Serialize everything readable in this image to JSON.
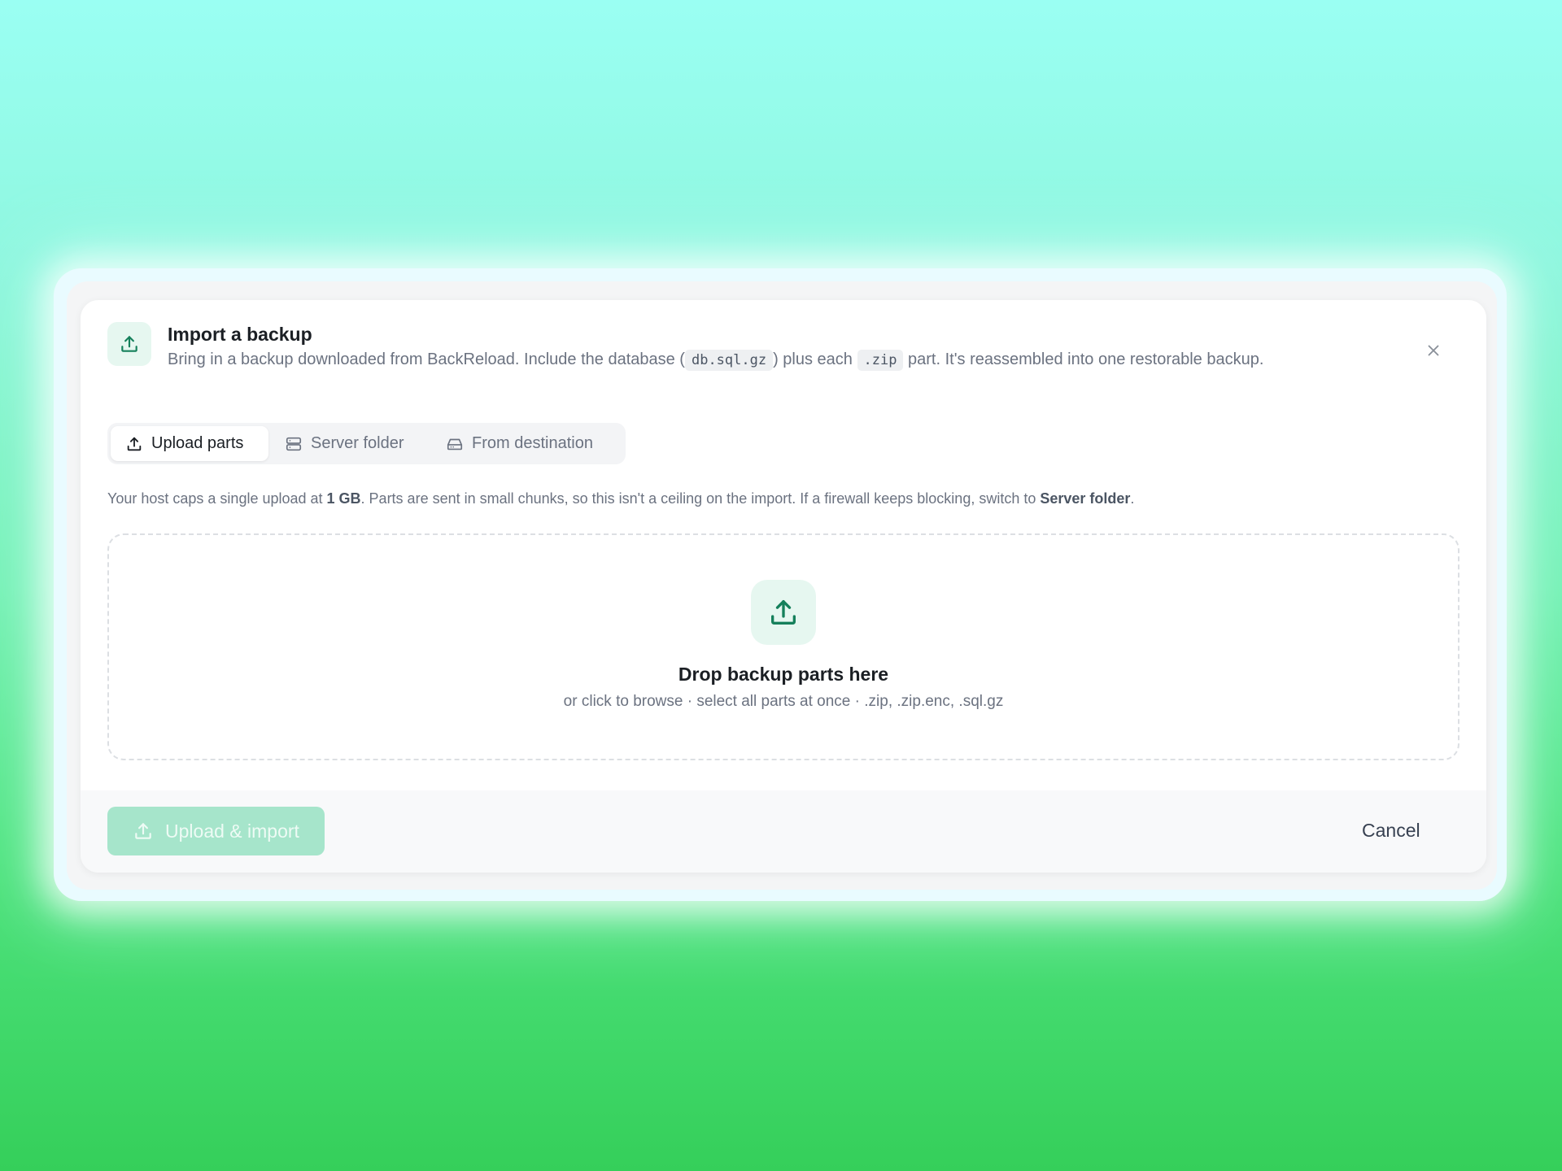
{
  "header": {
    "icon": "upload-icon",
    "title": "Import a backup",
    "desc_pre": "Bring in a backup downloaded from BackReload. Include the database (",
    "code_db": "db.sql.gz",
    "desc_mid": ") plus each",
    "code_zip": ".zip",
    "desc_post": "part. It's reassembled into one restorable backup.",
    "close_icon": "close-icon"
  },
  "tabs": [
    {
      "label": "Upload parts",
      "icon": "upload-icon",
      "active": true
    },
    {
      "label": "Server folder",
      "icon": "server-icon",
      "active": false
    },
    {
      "label": "From destination",
      "icon": "drive-icon",
      "active": false
    }
  ],
  "note": {
    "pre": "Your host caps a single upload at ",
    "limit": "1 GB",
    "mid": ". Parts are sent in small chunks, so this isn't a ceiling on the import. If a firewall keeps blocking, switch to ",
    "link": "Server folder",
    "post": "."
  },
  "dropzone": {
    "icon": "upload-icon",
    "title": "Drop backup parts here",
    "subtitle": "or click to browse · select all parts at once · .zip, .zip.enc, .sql.gz"
  },
  "footer": {
    "primary_label": "Upload & import",
    "cancel_label": "Cancel"
  },
  "colors": {
    "accent": "#15805b",
    "accent_soft": "#e6f7f0",
    "primary_disabled": "#a6e5cb"
  }
}
